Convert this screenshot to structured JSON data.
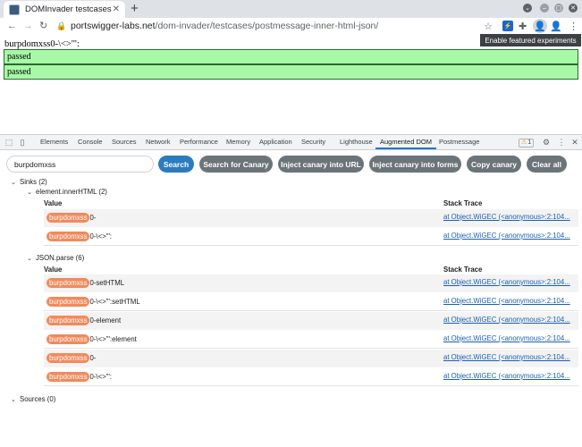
{
  "browser": {
    "tab_title": "DOMInvader testcases",
    "url_host": "portswigger-labs.net",
    "url_path": "/dom-invader/testcases/postmessage-inner-html-json/",
    "tooltip": "Enable featured experiments"
  },
  "page": {
    "heading": "burpdomxss0-\\<>'\":",
    "results": [
      "passed",
      "passed"
    ]
  },
  "devtools": {
    "tabs": [
      "Elements",
      "Console",
      "Sources",
      "Network",
      "Performance",
      "Memory",
      "Application",
      "Security",
      "Lighthouse",
      "Augmented DOM",
      "Postmessage"
    ],
    "active_tab": "Augmented DOM",
    "warning_count": "1"
  },
  "toolbar": {
    "search_value": "burpdomxss",
    "buttons": [
      "Search",
      "Search for Canary",
      "Inject canary into URL",
      "Inject canary into forms",
      "Copy canary",
      "Clear all"
    ]
  },
  "sinks": {
    "label": "Sinks (2)",
    "value_header": "Value",
    "trace_header": "Stack Trace",
    "groups": [
      {
        "name": "element.innerHTML (2)",
        "rows": [
          {
            "canary": "burpdomxss",
            "suffix": "0-",
            "trace": "at Object.WiGEC (<anonymous>:2:104..."
          },
          {
            "canary": "burpdomxss",
            "suffix": "0-\\<>'\":",
            "trace": "at Object.WiGEC (<anonymous>:2:104..."
          }
        ]
      },
      {
        "name": "JSON.parse (6)",
        "rows": [
          {
            "canary": "burpdomxss",
            "suffix": "0-setHTML",
            "trace": "at Object.WiGEC (<anonymous>:2:104..."
          },
          {
            "canary": "burpdomxss",
            "suffix": "0-\\<>'\":setHTML",
            "trace": "at Object.WiGEC (<anonymous>:2:104..."
          },
          {
            "canary": "burpdomxss",
            "suffix": "0-element",
            "trace": "at Object.WiGEC (<anonymous>:2:104..."
          },
          {
            "canary": "burpdomxss",
            "suffix": "0-\\<>'\":element",
            "trace": "at Object.WiGEC (<anonymous>:2:104..."
          },
          {
            "canary": "burpdomxss",
            "suffix": "0-",
            "trace": "at Object.WiGEC (<anonymous>:2:104..."
          },
          {
            "canary": "burpdomxss",
            "suffix": "0-\\<>'\":",
            "trace": "at Object.WiGEC (<anonymous>:2:104..."
          }
        ]
      }
    ]
  },
  "sources": {
    "label": "Sources (0)"
  },
  "colors": {
    "canary_badge": "#f08a5d",
    "search_button": "#2b7bbf",
    "gray_button": "#6b7479",
    "passed_bg": "#a7f9a7",
    "active_tab_underline": "#1a73e8"
  }
}
